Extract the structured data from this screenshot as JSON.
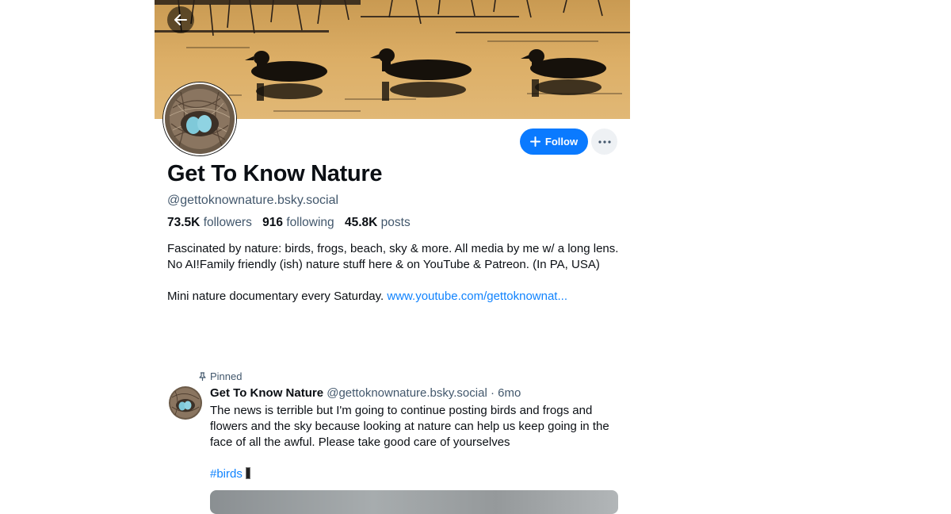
{
  "header": {
    "banner_icon": "banner-ducks-image",
    "back_icon": "arrow-left-icon"
  },
  "profile": {
    "display_name": "Get To Know Nature",
    "handle": "@gettoknownature.bsky.social",
    "followers_count": "73.5K",
    "followers_label": "followers",
    "following_count": "916",
    "following_label": "following",
    "posts_count": "45.8K",
    "posts_label": "posts",
    "bio_line1": "Fascinated by nature: birds, frogs, beach, sky & more. All media by me w/ a long lens. No AI!Family friendly (ish) nature stuff here & on YouTube & Patreon. (In PA, USA)",
    "bio_line2": "Mini nature documentary every Saturday.",
    "bio_link": "www.youtube.com/gettoknownat..."
  },
  "actions": {
    "follow_label": "Follow",
    "follow_icon": "plus-icon",
    "more_icon": "ellipsis-icon"
  },
  "pinned_post": {
    "pinned_label": "Pinned",
    "pin_icon": "pin-icon",
    "author_name": "Get To Know Nature",
    "author_handle": "@gettoknownature.bsky.social",
    "separator": "·",
    "time": "6mo",
    "text": "The news is terrible but I'm going to continue posting birds and frogs and flowers and the sky because looking at nature can help us keep going in the face of all the awful. Please take good care of yourselves",
    "hashtag": "#birds"
  },
  "colors": {
    "accent": "#0a7aff",
    "link": "#1083fe",
    "muted_text": "#42576c",
    "banner_water": "#d9a85e"
  }
}
